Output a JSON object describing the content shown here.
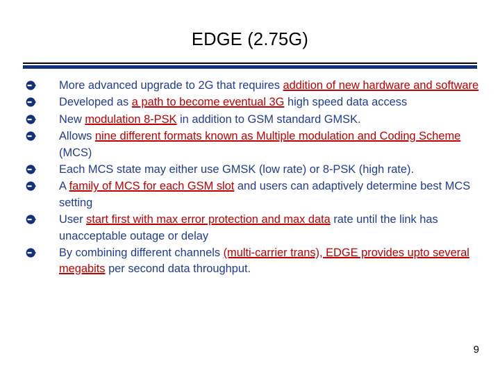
{
  "slide": {
    "title": "EDGE (2.75G)",
    "page_number": "9",
    "bullet_glyph": "circle-right-arrow",
    "colors": {
      "title_text": "#000000",
      "body_text": "#1F3C93",
      "emphasis_text": "#C00000",
      "bullet_marker": "#12307F",
      "rule_thin": "#000000",
      "rule_thick": "#12307F",
      "background": "#FFFFFF"
    },
    "bullets": [
      {
        "id": "bullet-1",
        "runs": [
          {
            "text": "More advanced upgrade to 2G that requires ",
            "emphasis": false
          },
          {
            "text": "addition of new hardware and software",
            "emphasis": true
          }
        ]
      },
      {
        "id": "bullet-2",
        "runs": [
          {
            "text": "Developed as ",
            "emphasis": false
          },
          {
            "text": "a path to become eventual 3G",
            "emphasis": true
          },
          {
            "text": " high speed data access",
            "emphasis": false
          }
        ]
      },
      {
        "id": "bullet-3",
        "runs": [
          {
            "text": "New ",
            "emphasis": false
          },
          {
            "text": "modulation 8-PSK",
            "emphasis": true
          },
          {
            "text": " in addition to GSM standard GMSK.",
            "emphasis": false
          }
        ]
      },
      {
        "id": "bullet-4",
        "runs": [
          {
            "text": "Allows ",
            "emphasis": false
          },
          {
            "text": "nine different formats known as Multiple modulation and Coding Scheme",
            "emphasis": true
          },
          {
            "text": " (MCS)",
            "emphasis": false
          }
        ]
      },
      {
        "id": "bullet-5",
        "runs": [
          {
            "text": "Each MCS state may either use GMSK (low rate) or 8-PSK (high rate).",
            "emphasis": false
          }
        ]
      },
      {
        "id": "bullet-6",
        "runs": [
          {
            "text": "A ",
            "emphasis": false
          },
          {
            "text": "family of MCS for each GSM slot",
            "emphasis": true
          },
          {
            "text": " and users can adaptively determine best MCS setting",
            "emphasis": false
          }
        ]
      },
      {
        "id": "bullet-7",
        "runs": [
          {
            "text": "User ",
            "emphasis": false
          },
          {
            "text": "start first with max error protection and max data",
            "emphasis": true
          },
          {
            "text": " rate until the link has unacceptable outage or delay",
            "emphasis": false
          }
        ]
      },
      {
        "id": "bullet-8",
        "runs": [
          {
            "text": "By combining different channels ",
            "emphasis": false
          },
          {
            "text": "(multi-carrier trans), EDGE provides upto several megabits",
            "emphasis": true
          },
          {
            "text": " per second data throughput.",
            "emphasis": false
          }
        ]
      }
    ]
  }
}
